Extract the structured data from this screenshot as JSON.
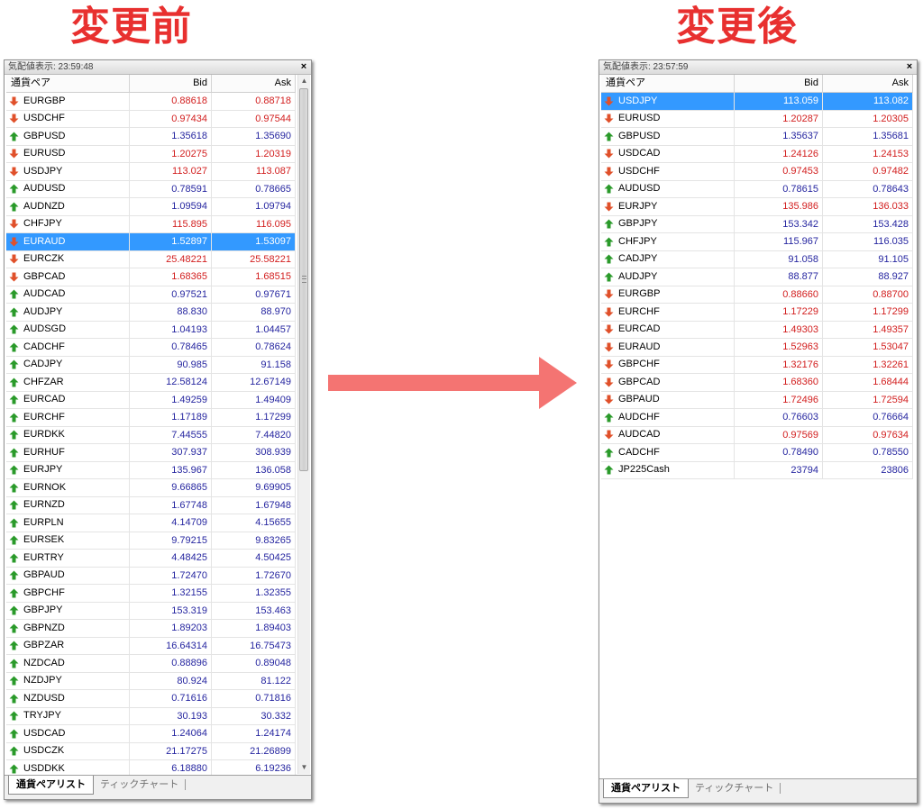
{
  "headings": {
    "before": "変更前",
    "after": "変更後"
  },
  "columns": {
    "symbol": "通貨ペア",
    "bid": "Bid",
    "ask": "Ask"
  },
  "tabs": {
    "symbols": "通貨ペアリスト",
    "tick_chart": "ティックチャート"
  },
  "close_glyph": "×",
  "colors": {
    "heading_red": "#e8302f",
    "bid_up_blue": "#2626a0",
    "bid_down_red": "#d21e1e",
    "selection_blue": "#3399ff",
    "up_arrow_green": "#2a9a2a",
    "down_arrow_orange": "#e0502a",
    "big_arrow": "#f47472"
  },
  "icons": {
    "up": "up-arrow-icon",
    "down": "down-arrow-icon",
    "close": "close-icon",
    "big_arrow": "right-arrow-icon"
  },
  "before": {
    "title": "気配値表示: 23:59:48",
    "rows": [
      {
        "symbol": "EURGBP",
        "bid": "0.88618",
        "ask": "0.88718",
        "dir": "down",
        "selected": false
      },
      {
        "symbol": "USDCHF",
        "bid": "0.97434",
        "ask": "0.97544",
        "dir": "down",
        "selected": false
      },
      {
        "symbol": "GBPUSD",
        "bid": "1.35618",
        "ask": "1.35690",
        "dir": "up",
        "selected": false
      },
      {
        "symbol": "EURUSD",
        "bid": "1.20275",
        "ask": "1.20319",
        "dir": "down",
        "selected": false
      },
      {
        "symbol": "USDJPY",
        "bid": "113.027",
        "ask": "113.087",
        "dir": "down",
        "selected": false
      },
      {
        "symbol": "AUDUSD",
        "bid": "0.78591",
        "ask": "0.78665",
        "dir": "up",
        "selected": false
      },
      {
        "symbol": "AUDNZD",
        "bid": "1.09594",
        "ask": "1.09794",
        "dir": "up",
        "selected": false
      },
      {
        "symbol": "CHFJPY",
        "bid": "115.895",
        "ask": "116.095",
        "dir": "down",
        "selected": false
      },
      {
        "symbol": "EURAUD",
        "bid": "1.52897",
        "ask": "1.53097",
        "dir": "down",
        "selected": true
      },
      {
        "symbol": "EURCZK",
        "bid": "25.48221",
        "ask": "25.58221",
        "dir": "down",
        "selected": false
      },
      {
        "symbol": "GBPCAD",
        "bid": "1.68365",
        "ask": "1.68515",
        "dir": "down",
        "selected": false
      },
      {
        "symbol": "AUDCAD",
        "bid": "0.97521",
        "ask": "0.97671",
        "dir": "up",
        "selected": false
      },
      {
        "symbol": "AUDJPY",
        "bid": "88.830",
        "ask": "88.970",
        "dir": "up",
        "selected": false
      },
      {
        "symbol": "AUDSGD",
        "bid": "1.04193",
        "ask": "1.04457",
        "dir": "up",
        "selected": false
      },
      {
        "symbol": "CADCHF",
        "bid": "0.78465",
        "ask": "0.78624",
        "dir": "up",
        "selected": false
      },
      {
        "symbol": "CADJPY",
        "bid": "90.985",
        "ask": "91.158",
        "dir": "up",
        "selected": false
      },
      {
        "symbol": "CHFZAR",
        "bid": "12.58124",
        "ask": "12.67149",
        "dir": "up",
        "selected": false
      },
      {
        "symbol": "EURCAD",
        "bid": "1.49259",
        "ask": "1.49409",
        "dir": "up",
        "selected": false
      },
      {
        "symbol": "EURCHF",
        "bid": "1.17189",
        "ask": "1.17299",
        "dir": "up",
        "selected": false
      },
      {
        "symbol": "EURDKK",
        "bid": "7.44555",
        "ask": "7.44820",
        "dir": "up",
        "selected": false
      },
      {
        "symbol": "EURHUF",
        "bid": "307.937",
        "ask": "308.939",
        "dir": "up",
        "selected": false
      },
      {
        "symbol": "EURJPY",
        "bid": "135.967",
        "ask": "136.058",
        "dir": "up",
        "selected": false
      },
      {
        "symbol": "EURNOK",
        "bid": "9.66865",
        "ask": "9.69905",
        "dir": "up",
        "selected": false
      },
      {
        "symbol": "EURNZD",
        "bid": "1.67748",
        "ask": "1.67948",
        "dir": "up",
        "selected": false
      },
      {
        "symbol": "EURPLN",
        "bid": "4.14709",
        "ask": "4.15655",
        "dir": "up",
        "selected": false
      },
      {
        "symbol": "EURSEK",
        "bid": "9.79215",
        "ask": "9.83265",
        "dir": "up",
        "selected": false
      },
      {
        "symbol": "EURTRY",
        "bid": "4.48425",
        "ask": "4.50425",
        "dir": "up",
        "selected": false
      },
      {
        "symbol": "GBPAUD",
        "bid": "1.72470",
        "ask": "1.72670",
        "dir": "up",
        "selected": false
      },
      {
        "symbol": "GBPCHF",
        "bid": "1.32155",
        "ask": "1.32355",
        "dir": "up",
        "selected": false
      },
      {
        "symbol": "GBPJPY",
        "bid": "153.319",
        "ask": "153.463",
        "dir": "up",
        "selected": false
      },
      {
        "symbol": "GBPNZD",
        "bid": "1.89203",
        "ask": "1.89403",
        "dir": "up",
        "selected": false
      },
      {
        "symbol": "GBPZAR",
        "bid": "16.64314",
        "ask": "16.75473",
        "dir": "up",
        "selected": false
      },
      {
        "symbol": "NZDCAD",
        "bid": "0.88896",
        "ask": "0.89048",
        "dir": "up",
        "selected": false
      },
      {
        "symbol": "NZDJPY",
        "bid": "80.924",
        "ask": "81.122",
        "dir": "up",
        "selected": false
      },
      {
        "symbol": "NZDUSD",
        "bid": "0.71616",
        "ask": "0.71816",
        "dir": "up",
        "selected": false
      },
      {
        "symbol": "TRYJPY",
        "bid": "30.193",
        "ask": "30.332",
        "dir": "up",
        "selected": false
      },
      {
        "symbol": "USDCAD",
        "bid": "1.24064",
        "ask": "1.24174",
        "dir": "up",
        "selected": false
      },
      {
        "symbol": "USDCZK",
        "bid": "21.17275",
        "ask": "21.26899",
        "dir": "up",
        "selected": false
      },
      {
        "symbol": "USDDKK",
        "bid": "6.18880",
        "ask": "6.19236",
        "dir": "up",
        "selected": false
      }
    ]
  },
  "after": {
    "title": "気配値表示: 23:57:59",
    "rows": [
      {
        "symbol": "USDJPY",
        "bid": "113.059",
        "ask": "113.082",
        "dir": "down",
        "selected": true
      },
      {
        "symbol": "EURUSD",
        "bid": "1.20287",
        "ask": "1.20305",
        "dir": "down",
        "selected": false
      },
      {
        "symbol": "GBPUSD",
        "bid": "1.35637",
        "ask": "1.35681",
        "dir": "up",
        "selected": false
      },
      {
        "symbol": "USDCAD",
        "bid": "1.24126",
        "ask": "1.24153",
        "dir": "down",
        "selected": false
      },
      {
        "symbol": "USDCHF",
        "bid": "0.97453",
        "ask": "0.97482",
        "dir": "down",
        "selected": false
      },
      {
        "symbol": "AUDUSD",
        "bid": "0.78615",
        "ask": "0.78643",
        "dir": "up",
        "selected": false
      },
      {
        "symbol": "EURJPY",
        "bid": "135.986",
        "ask": "136.033",
        "dir": "down",
        "selected": false
      },
      {
        "symbol": "GBPJPY",
        "bid": "153.342",
        "ask": "153.428",
        "dir": "up",
        "selected": false
      },
      {
        "symbol": "CHFJPY",
        "bid": "115.967",
        "ask": "116.035",
        "dir": "up",
        "selected": false
      },
      {
        "symbol": "CADJPY",
        "bid": "91.058",
        "ask": "91.105",
        "dir": "up",
        "selected": false
      },
      {
        "symbol": "AUDJPY",
        "bid": "88.877",
        "ask": "88.927",
        "dir": "up",
        "selected": false
      },
      {
        "symbol": "EURGBP",
        "bid": "0.88660",
        "ask": "0.88700",
        "dir": "down",
        "selected": false
      },
      {
        "symbol": "EURCHF",
        "bid": "1.17229",
        "ask": "1.17299",
        "dir": "down",
        "selected": false
      },
      {
        "symbol": "EURCAD",
        "bid": "1.49303",
        "ask": "1.49357",
        "dir": "down",
        "selected": false
      },
      {
        "symbol": "EURAUD",
        "bid": "1.52963",
        "ask": "1.53047",
        "dir": "down",
        "selected": false
      },
      {
        "symbol": "GBPCHF",
        "bid": "1.32176",
        "ask": "1.32261",
        "dir": "down",
        "selected": false
      },
      {
        "symbol": "GBPCAD",
        "bid": "1.68360",
        "ask": "1.68444",
        "dir": "down",
        "selected": false
      },
      {
        "symbol": "GBPAUD",
        "bid": "1.72496",
        "ask": "1.72594",
        "dir": "down",
        "selected": false
      },
      {
        "symbol": "AUDCHF",
        "bid": "0.76603",
        "ask": "0.76664",
        "dir": "up",
        "selected": false
      },
      {
        "symbol": "AUDCAD",
        "bid": "0.97569",
        "ask": "0.97634",
        "dir": "down",
        "selected": false
      },
      {
        "symbol": "CADCHF",
        "bid": "0.78490",
        "ask": "0.78550",
        "dir": "up",
        "selected": false
      },
      {
        "symbol": "JP225Cash",
        "bid": "23794",
        "ask": "23806",
        "dir": "up",
        "selected": false
      }
    ]
  }
}
